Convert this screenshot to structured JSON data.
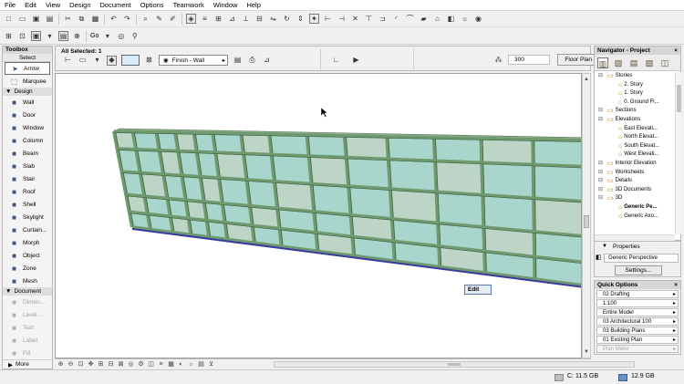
{
  "menubar": [
    "File",
    "Edit",
    "View",
    "Design",
    "Document",
    "Options",
    "Teamwork",
    "Window",
    "Help"
  ],
  "toolbar": {
    "go_label": "Go"
  },
  "toolbox": {
    "title": "Toolbox",
    "select_label": "Select",
    "tools_top": [
      {
        "label": "Arrow",
        "icon": "arrow-icon"
      },
      {
        "label": "Marquee",
        "icon": "marquee-icon"
      }
    ],
    "design_label": "Design",
    "design_tools": [
      {
        "label": "Wall",
        "icon": "wall-icon"
      },
      {
        "label": "Door",
        "icon": "door-icon"
      },
      {
        "label": "Window",
        "icon": "window-icon"
      },
      {
        "label": "Column",
        "icon": "column-icon"
      },
      {
        "label": "Beam",
        "icon": "beam-icon"
      },
      {
        "label": "Slab",
        "icon": "slab-icon"
      },
      {
        "label": "Stair",
        "icon": "stair-icon"
      },
      {
        "label": "Roof",
        "icon": "roof-icon"
      },
      {
        "label": "Shell",
        "icon": "shell-icon"
      },
      {
        "label": "Skylight",
        "icon": "skylight-icon"
      },
      {
        "label": "Curtain...",
        "icon": "curtain-wall-icon"
      },
      {
        "label": "Morph",
        "icon": "morph-icon"
      },
      {
        "label": "Object",
        "icon": "object-icon"
      },
      {
        "label": "Zone",
        "icon": "zone-icon"
      },
      {
        "label": "Mesh",
        "icon": "mesh-icon"
      }
    ],
    "document_label": "Document",
    "document_tools": [
      {
        "label": "Dimen...",
        "icon": "dimension-icon"
      },
      {
        "label": "Level ...",
        "icon": "level-dimension-icon"
      },
      {
        "label": "Text",
        "icon": "text-icon"
      },
      {
        "label": "Label",
        "icon": "label-icon"
      },
      {
        "label": "Fill",
        "icon": "fill-icon"
      }
    ],
    "more_label": "More"
  },
  "infobox": {
    "all_selected": "All Selected: 1",
    "finish_label": "Finish - Wall",
    "value": "300",
    "floorplan_button": "Floor Plan and Section..."
  },
  "viewport": {
    "edit_label": "Edit"
  },
  "navigator": {
    "title": "Navigator - Project",
    "tree": [
      {
        "label": "Stories",
        "depth": 1
      },
      {
        "label": "2. Story",
        "depth": 2
      },
      {
        "label": "1. Story",
        "depth": 2
      },
      {
        "label": "0. Ground Fl...",
        "depth": 2
      },
      {
        "label": "Sections",
        "depth": 1
      },
      {
        "label": "Elevations",
        "depth": 1
      },
      {
        "label": "East Elevati...",
        "depth": 2
      },
      {
        "label": "North Elevat...",
        "depth": 2
      },
      {
        "label": "South Elevat...",
        "depth": 2
      },
      {
        "label": "West Elevati...",
        "depth": 2
      },
      {
        "label": "Interior Elevation",
        "depth": 1
      },
      {
        "label": "Worksheets",
        "depth": 1
      },
      {
        "label": "Details",
        "depth": 1
      },
      {
        "label": "3D Documents",
        "depth": 1
      },
      {
        "label": "3D",
        "depth": 1
      },
      {
        "label": "Generic Pe...",
        "depth": 2
      },
      {
        "label": "Generic Axo...",
        "depth": 2
      }
    ]
  },
  "properties": {
    "title": "Properties",
    "value": "Generic Perspective",
    "settings_button": "Settings..."
  },
  "quick_options": {
    "title": "Quick Options",
    "rows": [
      "02 Drafting",
      "1:100",
      "Entire Model",
      "03 Architectural 100",
      "03 Building Plans",
      "01 Existing Plan",
      "Plan Meter"
    ]
  },
  "status": {
    "c_drive": "C: 11.5 GB",
    "memory": "12.9 GB"
  },
  "colors": {
    "glass": "#a8d6cc",
    "mullion": "#6f9a6f",
    "base": "#3a3aa0",
    "selection": "#3c68b0"
  }
}
